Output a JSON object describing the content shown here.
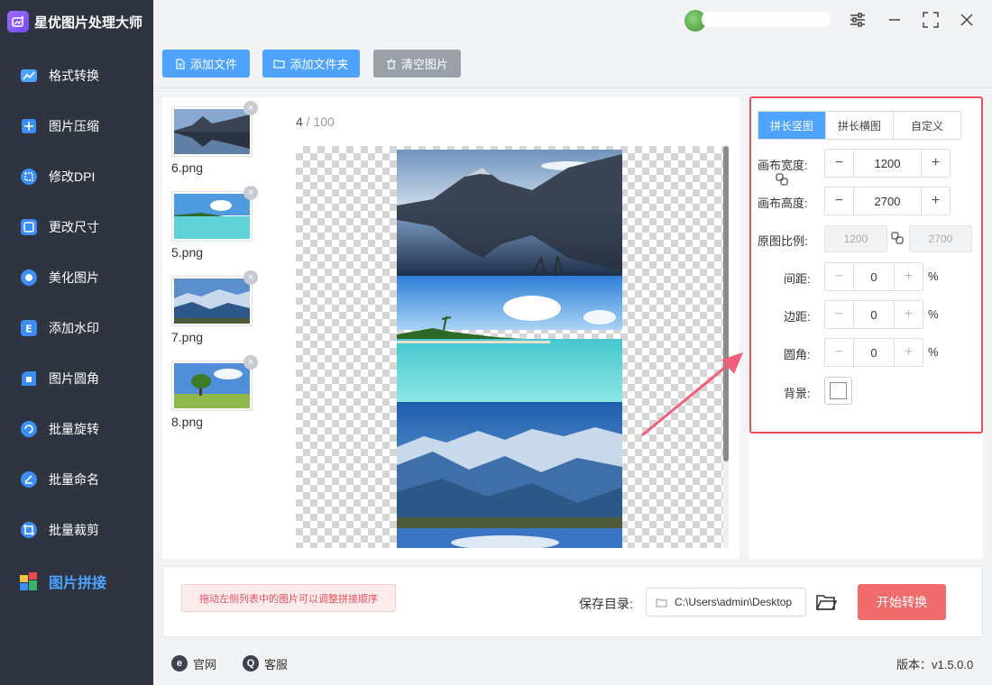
{
  "app": {
    "title": "星优图片处理大师",
    "logo_icon": "magic-wand-icon"
  },
  "sidebar": {
    "items": [
      {
        "label": "格式转换",
        "icon": "format-convert-icon",
        "color": "#3c8df6"
      },
      {
        "label": "图片压缩",
        "icon": "compress-icon",
        "color": "#3c8df6"
      },
      {
        "label": "修改DPI",
        "icon": "dpi-icon",
        "color": "#3c8df6"
      },
      {
        "label": "更改尺寸",
        "icon": "resize-icon",
        "color": "#3c8df6"
      },
      {
        "label": "美化图片",
        "icon": "beautify-icon",
        "color": "#3c8df6"
      },
      {
        "label": "添加水印",
        "icon": "watermark-icon",
        "color": "#3c8df6"
      },
      {
        "label": "图片圆角",
        "icon": "round-corner-icon",
        "color": "#3c8df6"
      },
      {
        "label": "批量旋转",
        "icon": "rotate-icon",
        "color": "#3c8df6"
      },
      {
        "label": "批量命名",
        "icon": "rename-icon",
        "color": "#3c8df6"
      },
      {
        "label": "批量裁剪",
        "icon": "crop-icon",
        "color": "#3c8df6"
      },
      {
        "label": "图片拼接",
        "icon": "stitch-icon",
        "color": "#4da3ff",
        "active": true
      }
    ]
  },
  "toolbar": {
    "add_file": "添加文件",
    "add_folder": "添加文件夹",
    "clear": "清空图片"
  },
  "files": [
    {
      "name": "6.png",
      "scene": "mountain-lake"
    },
    {
      "name": "5.png",
      "scene": "beach"
    },
    {
      "name": "7.png",
      "scene": "blue-mountains"
    },
    {
      "name": "8.png",
      "scene": "tree-field"
    }
  ],
  "preview": {
    "current": "4",
    "separator": " / ",
    "total": "100"
  },
  "settings": {
    "tabs": [
      "拼长竖图",
      "拼长横图",
      "自定义"
    ],
    "active_tab": 0,
    "canvas_width_label": "画布宽度:",
    "canvas_width": "1200",
    "canvas_height_label": "画布高度:",
    "canvas_height": "2700",
    "ratio_label": "原图比例:",
    "ratio_width": "1200",
    "ratio_height": "2700",
    "spacing_label": "间距:",
    "spacing": "0",
    "margin_label": "边距:",
    "margin": "0",
    "radius_label": "圆角:",
    "radius": "0",
    "percent": "%",
    "background_label": "背景:",
    "background_color": "#ffffff"
  },
  "bottom": {
    "tip": "拖动左侧列表中的图片可以调整拼接顺序",
    "save_label": "保存目录:",
    "save_path": "C:\\Users\\admin\\Desktop",
    "start": "开始转换"
  },
  "footer": {
    "website": "官网",
    "support": "客服",
    "version": "版本：v1.5.0.0"
  },
  "colors": {
    "accent": "#4da3ff",
    "highlight_border": "#e8515c",
    "start_button": "#f06b6b",
    "sidebar_bg": "#2e3440"
  }
}
